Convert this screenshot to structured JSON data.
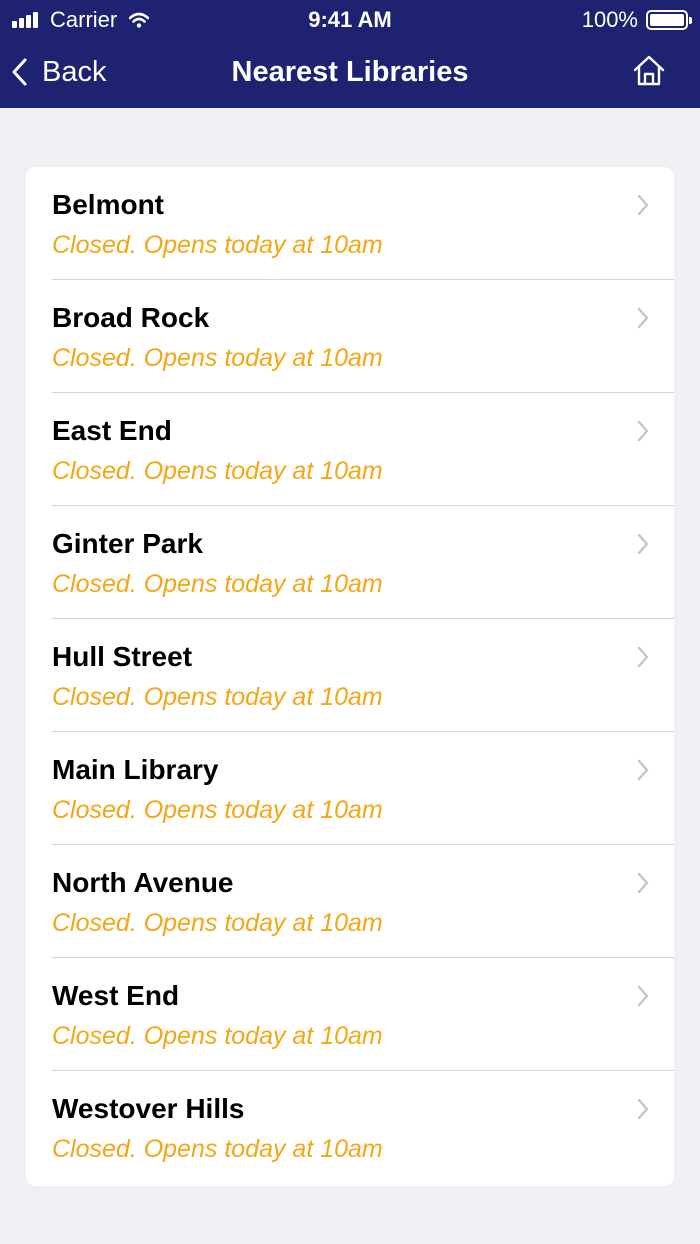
{
  "status_bar": {
    "carrier": "Carrier",
    "time": "9:41 AM",
    "battery": "100%"
  },
  "nav": {
    "back_label": "Back",
    "title": "Nearest Libraries",
    "home_icon": "home-icon"
  },
  "colors": {
    "nav_background": "#1f2270",
    "status_text": "#f5a614",
    "page_background": "#efeff4"
  },
  "libraries": [
    {
      "name": "Belmont",
      "status": "Closed. Opens today at 10am"
    },
    {
      "name": "Broad Rock",
      "status": "Closed. Opens today at 10am"
    },
    {
      "name": "East End",
      "status": "Closed. Opens today at 10am"
    },
    {
      "name": "Ginter Park",
      "status": "Closed. Opens today at 10am"
    },
    {
      "name": "Hull Street",
      "status": "Closed. Opens today at 10am"
    },
    {
      "name": "Main Library",
      "status": "Closed. Opens today at 10am"
    },
    {
      "name": "North Avenue",
      "status": "Closed. Opens today at 10am"
    },
    {
      "name": "West End",
      "status": "Closed. Opens today at 10am"
    },
    {
      "name": "Westover Hills",
      "status": "Closed. Opens today at 10am"
    }
  ]
}
